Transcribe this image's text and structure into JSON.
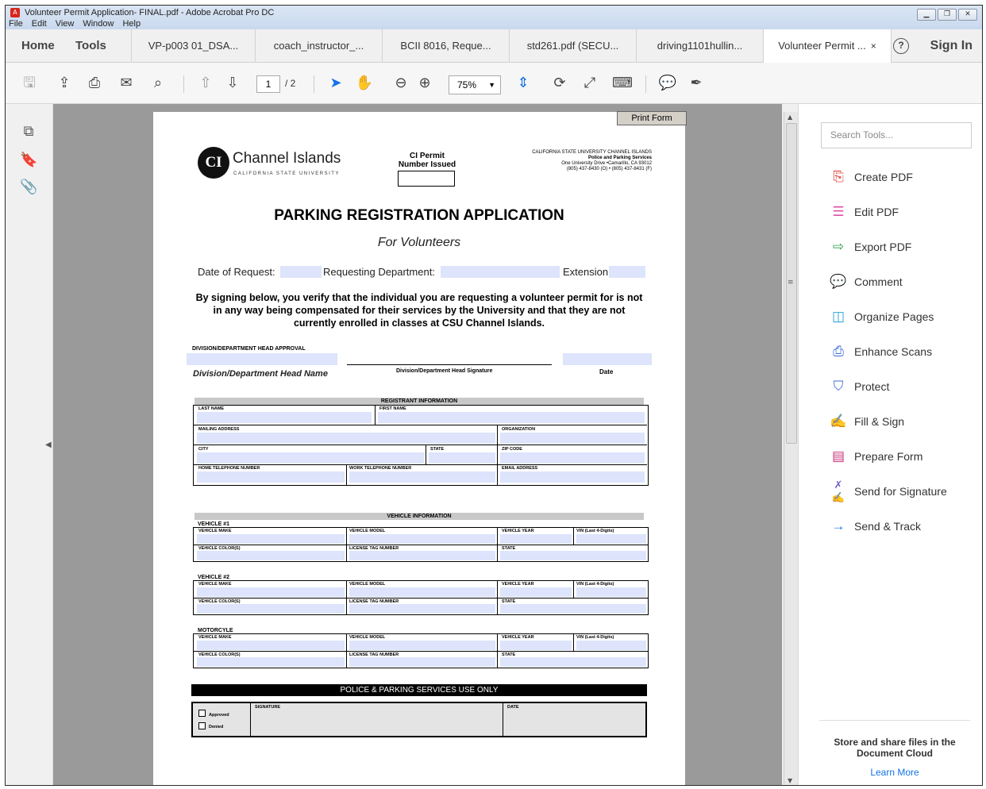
{
  "window": {
    "title": "Volunteer Permit Application- FINAL.pdf - Adobe Acrobat Pro DC",
    "menu": [
      "File",
      "Edit",
      "View",
      "Window",
      "Help"
    ]
  },
  "nav": {
    "home": "Home",
    "tools": "Tools",
    "sign_in": "Sign In",
    "help": "?"
  },
  "tabs": [
    {
      "label": "VP-p003 01_DSA..."
    },
    {
      "label": "coach_instructor_..."
    },
    {
      "label": "BCII 8016, Reque..."
    },
    {
      "label": "std261.pdf (SECU..."
    },
    {
      "label": "driving1101hullin..."
    },
    {
      "label": "Volunteer Permit ...",
      "close": "×"
    }
  ],
  "toolbar": {
    "page_current": "1",
    "page_total": "/ 2",
    "zoom": "75%"
  },
  "document": {
    "print_form": "Print Form",
    "logo_name": "Channel Islands",
    "logo_sub": "CALIFORNIA STATE UNIVERSITY",
    "permit_label_1": "CI Permit",
    "permit_label_2": "Number Issued",
    "address": [
      "CALIFORNIA STATE UNIVERSITY CHANNEL ISLANDS",
      "Police and Parking Services",
      "One University Drive •Camarillo, CA 93012",
      "(805) 437-8430 (O) • (805) 437-8431 (F)"
    ],
    "title": "PARKING REGISTRATION APPLICATION",
    "subtitle": "For Volunteers",
    "date_of_request": "Date of Request:",
    "requesting_department": "Requesting Department:",
    "extension": "Extension",
    "notice": "By signing below, you verify that the individual you are requesting a volunteer permit for is not in any way being compensated for their services by the University and that they are not currently enrolled in classes at CSU Channel Islands.",
    "approval_heading": "DIVISION/DEPARTMENT HEAD APPROVAL",
    "head_name": "Division/Department Head Name",
    "head_signature": "Division/Department Head Signature",
    "date": "Date",
    "registrant_heading": "REGISTRANT INFORMATION",
    "registrant": {
      "last_name": "LAST NAME",
      "first_name": "FIRST NAME",
      "mailing_address": "MAILING ADDRESS",
      "organization": "ORGANIZATION",
      "city": "CITY",
      "state": "STATE",
      "zip": "ZIP CODE",
      "home_phone": "HOME TELEPHONE NUMBER",
      "work_phone": "WORK TELEPHONE NUMBER",
      "email": "EMAIL ADDRESS"
    },
    "vehicle_heading": "VEHICLE INFORMATION",
    "vehicles": [
      {
        "label": "VEHICLE #1"
      },
      {
        "label": "VEHICLE #2"
      },
      {
        "label": "MOTORCYLE"
      }
    ],
    "vehicle_fields": {
      "make": "VEHICLE MAKE",
      "model": "VEHICLE MODEL",
      "year": "VEHICLE YEAR",
      "vin": "VIN (Last 4-Digits)",
      "color": "VEHICLE COLOR(S)",
      "tag": "LICENSE TAG NUMBER",
      "state": "STATE"
    },
    "office_heading": "POLICE & PARKING SERVICES USE ONLY",
    "approved": "Approved",
    "denied": "Denied",
    "signature": "SIGNATURE",
    "office_date": "DATE"
  },
  "tools_pane": {
    "search_placeholder": "Search Tools...",
    "items": [
      {
        "label": "Create PDF",
        "icon": "create-pdf-icon",
        "color": "#e0312b"
      },
      {
        "label": "Edit PDF",
        "icon": "edit-pdf-icon",
        "color": "#e04fa7"
      },
      {
        "label": "Export PDF",
        "icon": "export-pdf-icon",
        "color": "#2da44e"
      },
      {
        "label": "Comment",
        "icon": "comment-icon",
        "color": "#f2b21b"
      },
      {
        "label": "Organize Pages",
        "icon": "organize-pages-icon",
        "color": "#27a0d8"
      },
      {
        "label": "Enhance Scans",
        "icon": "enhance-scans-icon",
        "color": "#3b6bd6"
      },
      {
        "label": "Protect",
        "icon": "protect-icon",
        "color": "#3b6bd6"
      },
      {
        "label": "Fill & Sign",
        "icon": "fill-sign-icon",
        "color": "#7561c9"
      },
      {
        "label": "Prepare Form",
        "icon": "prepare-form-icon",
        "color": "#c8327a"
      },
      {
        "label": "Send for Signature",
        "icon": "send-signature-icon",
        "color": "#7561c9"
      },
      {
        "label": "Send & Track",
        "icon": "send-track-icon",
        "color": "#1473e6"
      }
    ],
    "cloud_text": "Store and share files in the Document Cloud",
    "learn_more": "Learn More"
  }
}
